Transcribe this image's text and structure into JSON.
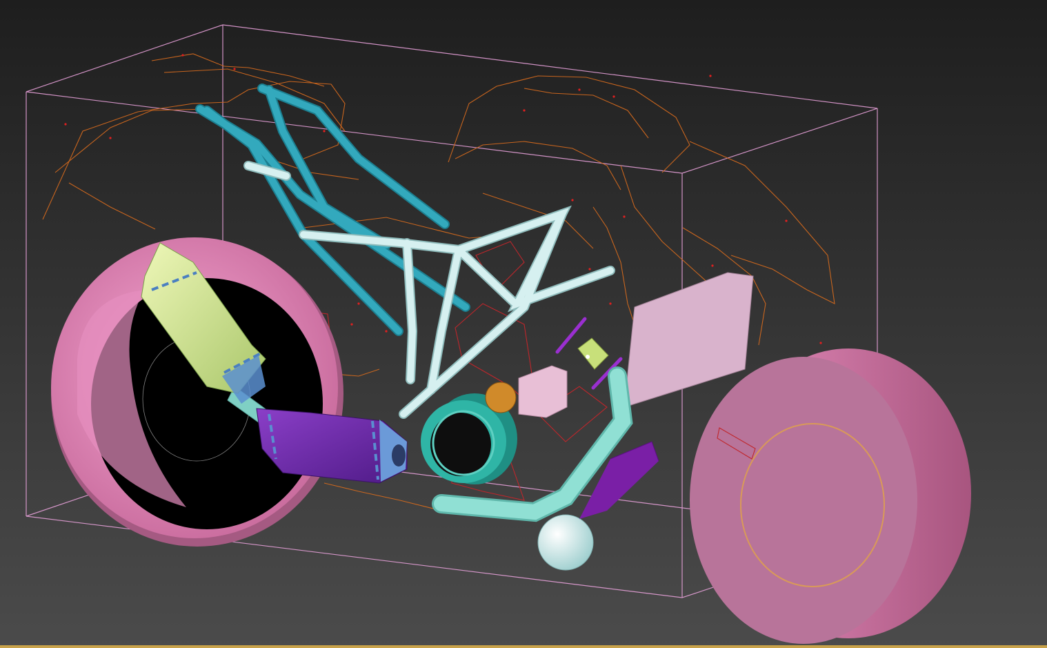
{
  "viewport": {
    "background_top": "#1f1f1f",
    "background_bottom": "#4a4a4a",
    "active_border_color": "#c8a24a"
  },
  "scene": {
    "bounding_box_color": "#e6a0d8",
    "spline_color": "#d2691e",
    "vertex_dot_color": "#e02020",
    "objects": [
      {
        "name": "rear-wheel-tire",
        "color": "#e58fbf"
      },
      {
        "name": "front-wheel",
        "color": "#d87aa9"
      },
      {
        "name": "rear-frame-tubes",
        "color": "#2ea3b7"
      },
      {
        "name": "main-frame-tubes",
        "color": "#bfe6e6"
      },
      {
        "name": "exhaust-muffler-upper",
        "color": "#d9ef9a"
      },
      {
        "name": "exhaust-muffler-lower",
        "color": "#7a2fb0"
      },
      {
        "name": "exhaust-pipe",
        "color": "#8fdcd0"
      },
      {
        "name": "headlight-ring",
        "color": "#2fb5a6"
      },
      {
        "name": "orange-sphere",
        "color": "#d08a2a"
      },
      {
        "name": "pink-box",
        "color": "#e8bfd6"
      },
      {
        "name": "side-panel",
        "color": "#d9b3cc"
      },
      {
        "name": "front-fork-pipe",
        "color": "#8fdcd0"
      },
      {
        "name": "ball",
        "color": "#d7f2f2"
      },
      {
        "name": "purple-plate",
        "color": "#7a1fa6"
      },
      {
        "name": "small-block",
        "color": "#c8e07a"
      },
      {
        "name": "purple-rods",
        "color": "#9a2fd0"
      }
    ]
  }
}
